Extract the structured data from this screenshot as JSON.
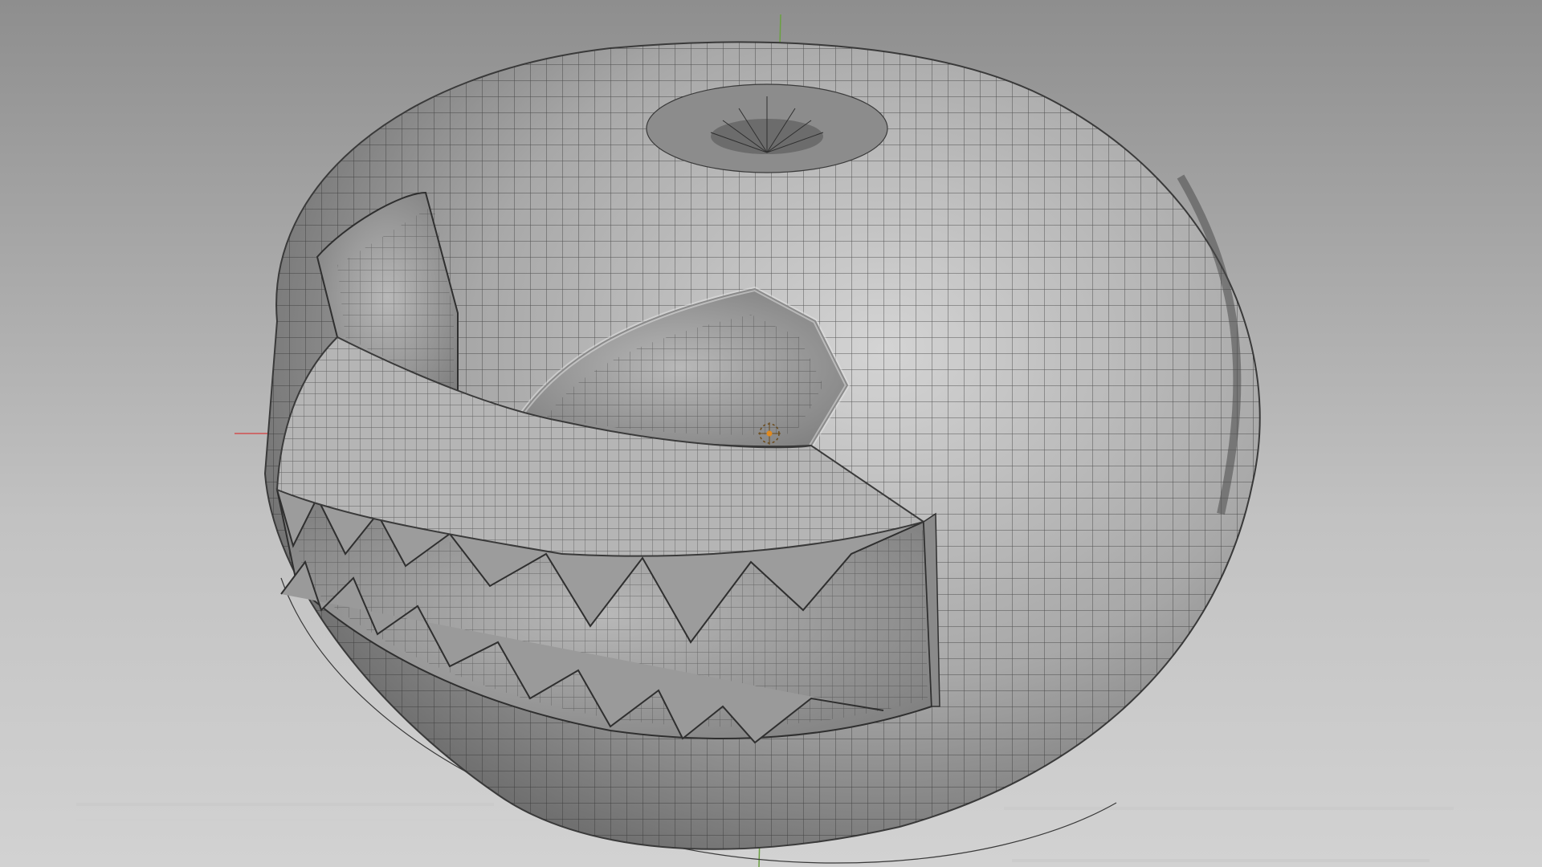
{
  "viewport": {
    "mode": "3D Viewport",
    "shading": "solid",
    "overlay": "wireframe"
  },
  "object": {
    "name": "",
    "kind": "jack-o-lantern mesh"
  },
  "colors": {
    "background_top": "#8c8c8c",
    "background_mid": "#bdbdbd",
    "background_bottom": "#d0d0d0",
    "mesh_light": "#c9c9c9",
    "mesh_mid": "#9a9a9a",
    "mesh_dark": "#5a5a5a",
    "wire": "#2f2f2f",
    "axis_x": "#d05050",
    "axis_y": "#6aa040",
    "origin": "#e08a20"
  },
  "icons": {
    "origin_marker": "origin-dot-icon",
    "cursor_3d": "3d-cursor-icon"
  }
}
